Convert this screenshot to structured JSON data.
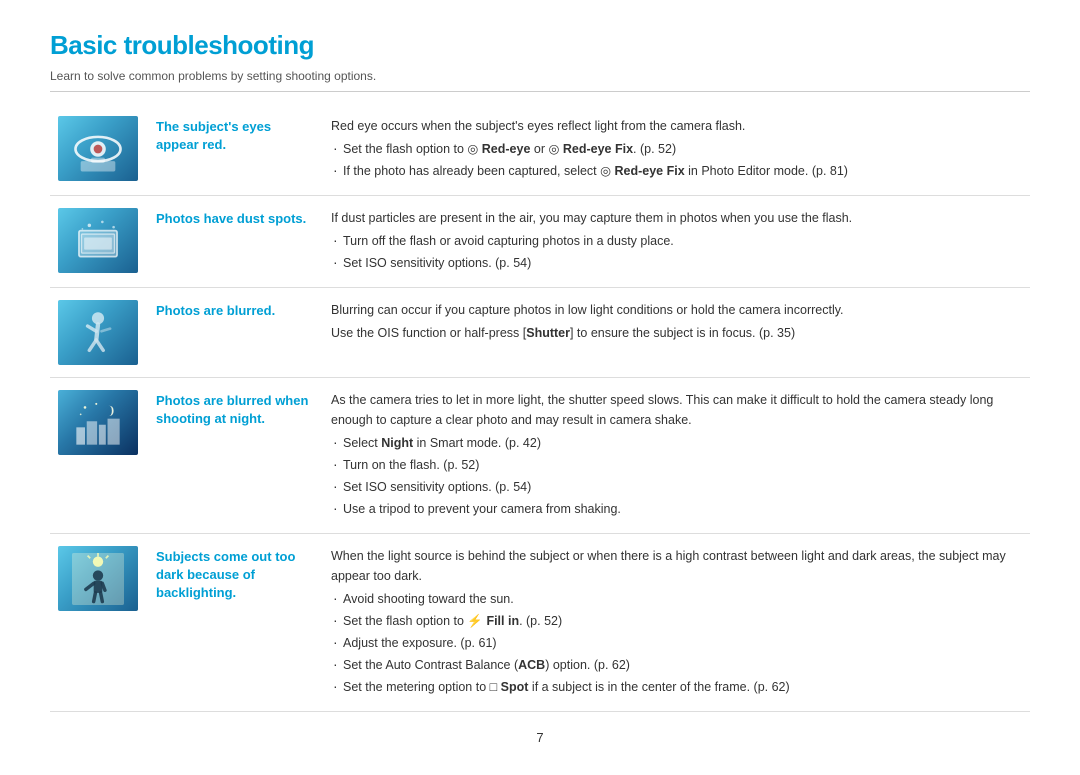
{
  "page": {
    "title": "Basic troubleshooting",
    "subtitle": "Learn to solve common problems by setting shooting options.",
    "page_number": "7"
  },
  "rows": [
    {
      "id": "red-eye",
      "problem_title": "The subject's eyes appear red.",
      "content_lines": [
        {
          "type": "text",
          "text": "Red eye occurs when the subject's eyes reflect light from the camera flash."
        },
        {
          "type": "bullet",
          "text": "Set the flash option to  Red-eye or  Red-eye Fix. (p. 52)"
        },
        {
          "type": "bullet",
          "text": "If the photo has already been captured, select  Red-eye Fix in Photo Editor mode. (p. 81)"
        }
      ]
    },
    {
      "id": "dust",
      "problem_title": "Photos have dust spots.",
      "content_lines": [
        {
          "type": "text",
          "text": "If dust particles are present in the air, you may capture them in photos when you use the flash."
        },
        {
          "type": "bullet",
          "text": "Turn off the flash or avoid capturing photos in a dusty place."
        },
        {
          "type": "bullet",
          "text": "Set ISO sensitivity options. (p. 54)"
        }
      ]
    },
    {
      "id": "blurred",
      "problem_title": "Photos are blurred.",
      "content_lines": [
        {
          "type": "text",
          "text": "Blurring can occur if you capture photos in low light conditions or hold the camera incorrectly."
        },
        {
          "type": "text",
          "text": "Use the OIS function or half-press [Shutter] to ensure the subject is in focus. (p. 35)"
        }
      ]
    },
    {
      "id": "night",
      "problem_title": "Photos are blurred when shooting at night.",
      "content_lines": [
        {
          "type": "text",
          "text": "As the camera tries to let in more light, the shutter speed slows. This can make it difficult to hold the camera steady long enough to capture a clear photo and may result in camera shake."
        },
        {
          "type": "bullet",
          "text": "Select Night in Smart mode. (p. 42)"
        },
        {
          "type": "bullet",
          "text": "Turn on the flash. (p. 52)"
        },
        {
          "type": "bullet",
          "text": "Set ISO sensitivity options. (p. 54)"
        },
        {
          "type": "bullet",
          "text": "Use a tripod to prevent your camera from shaking."
        }
      ]
    },
    {
      "id": "backlight",
      "problem_title": "Subjects come out too dark because of backlighting.",
      "content_lines": [
        {
          "type": "text",
          "text": "When the light source is behind the subject or when there is a high contrast between light and dark areas, the subject may appear too dark."
        },
        {
          "type": "bullet",
          "text": "Avoid shooting toward the sun."
        },
        {
          "type": "bullet",
          "text": "Set the flash option to  Fill in. (p. 52)"
        },
        {
          "type": "bullet",
          "text": "Adjust the exposure. (p. 61)"
        },
        {
          "type": "bullet",
          "text": "Set the Auto Contrast Balance (ACB) option. (p. 62)"
        },
        {
          "type": "bullet",
          "text": "Set the metering option to  Spot if a subject is in the center of the frame. (p. 62)"
        }
      ]
    }
  ]
}
